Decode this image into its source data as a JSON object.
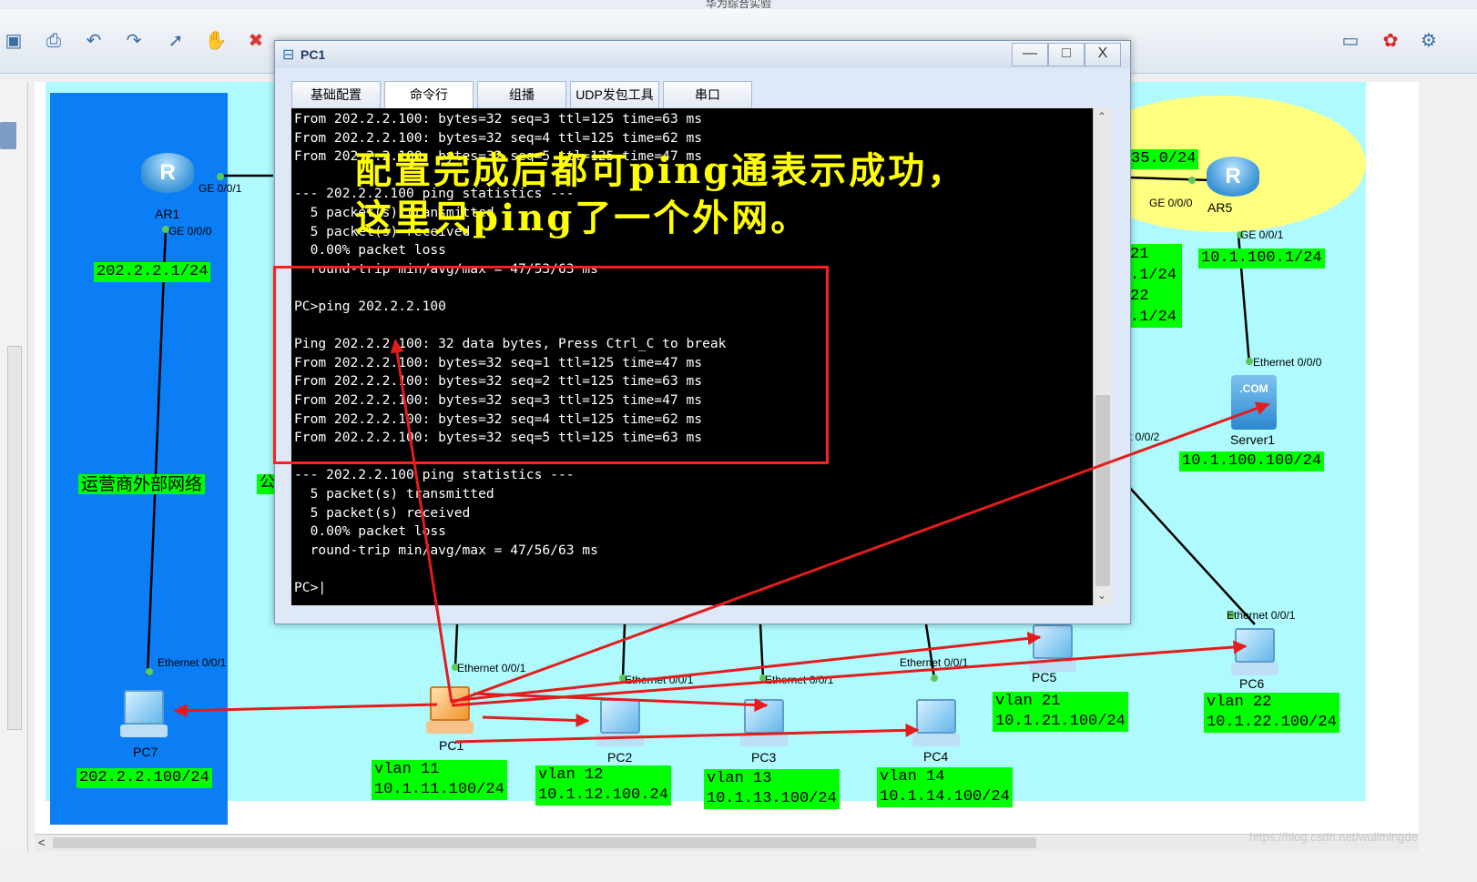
{
  "app": {
    "title": "华为综合实验"
  },
  "window": {
    "title": "PC1",
    "minimize": "—",
    "maximize": "□",
    "close": "X",
    "tabs": [
      "基础配置",
      "命令行",
      "组播",
      "UDP发包工具",
      "串口"
    ],
    "terminal_lines": [
      "From 202.2.2.100: bytes=32 seq=3 ttl=125 time=63 ms",
      "From 202.2.2.100: bytes=32 seq=4 ttl=125 time=62 ms",
      "From 202.2.2.100: bytes=32 seq=5 ttl=125 time=47 ms",
      "",
      "--- 202.2.2.100 ping statistics ---",
      "  5 packet(s) transmitted",
      "  5 packet(s) received",
      "  0.00% packet loss",
      "  round-trip min/avg/max = 47/53/63 ms",
      "",
      "PC>ping 202.2.2.100",
      "",
      "Ping 202.2.2.100: 32 data bytes, Press Ctrl_C to break",
      "From 202.2.2.100: bytes=32 seq=1 ttl=125 time=47 ms",
      "From 202.2.2.100: bytes=32 seq=2 ttl=125 time=63 ms",
      "From 202.2.2.100: bytes=32 seq=3 ttl=125 time=47 ms",
      "From 202.2.2.100: bytes=32 seq=4 ttl=125 time=62 ms",
      "From 202.2.2.100: bytes=32 seq=5 ttl=125 time=63 ms",
      "",
      "--- 202.2.2.100 ping statistics ---",
      "  5 packet(s) transmitted",
      "  5 packet(s) received",
      "  0.00% packet loss",
      "  round-trip min/avg/max = 47/56/63 ms",
      "",
      "PC>|"
    ]
  },
  "annotation": {
    "line1": "配置完成后都可ping通表示成功，",
    "line2": "这里只ping了一个外网。"
  },
  "topology": {
    "operator_label": "运营商外部网络",
    "ar1": {
      "name": "AR1",
      "port1": "GE 0/0/1",
      "port2": "GE 0/0/0",
      "ip": "202.2.2.1/24"
    },
    "ar5": {
      "name": "AR5",
      "port1": "GE 0/0/0",
      "port2": "GE 0/0/1",
      "ip": "10.1.100.1/24",
      "net": "35.0/24"
    },
    "partial_labels": [
      "21",
      ".1/24",
      "22",
      ".1/24"
    ],
    "partial_port": "t 0/0/2",
    "server1": {
      "name": "Server1",
      "port": "Ethernet 0/0/0",
      "ip": "10.1.100.100/24"
    },
    "pc7": {
      "name": "PC7",
      "port": "Ethernet 0/0/1",
      "ip": "202.2.2.100/24"
    },
    "pc1": {
      "name": "PC1",
      "port": "Ethernet 0/0/1",
      "vlan": "vlan 11",
      "ip": "10.1.11.100/24"
    },
    "pc2": {
      "name": "PC2",
      "port": "Ethernet 0/0/1",
      "vlan": "vlan 12",
      "ip": "10.1.12.100.24"
    },
    "pc3": {
      "name": "PC3",
      "port": "Ethernet 0/0/1",
      "vlan": "vlan 13",
      "ip": "10.1.13.100/24"
    },
    "pc4": {
      "name": "PC4",
      "port": "Ethernet 0/0/1",
      "vlan": "vlan 14",
      "ip": "10.1.14.100/24"
    },
    "pc5": {
      "name": "PC5",
      "vlan": "vlan 21",
      "ip": "10.1.21.100/24"
    },
    "pc6": {
      "name": "PC6",
      "port": "Ethernet 0/0/1",
      "vlan": "vlan 22",
      "ip": "10.1.22.100/24"
    }
  },
  "watermark": "https://blog.csdn.net/wulimingde",
  "colors": {
    "label_bg": "#00ff00",
    "annotation": "#ffff00",
    "arrow": "#e51c1c",
    "zone_blue": "#0b7ef5",
    "zone_cyan": "#aefafe"
  }
}
